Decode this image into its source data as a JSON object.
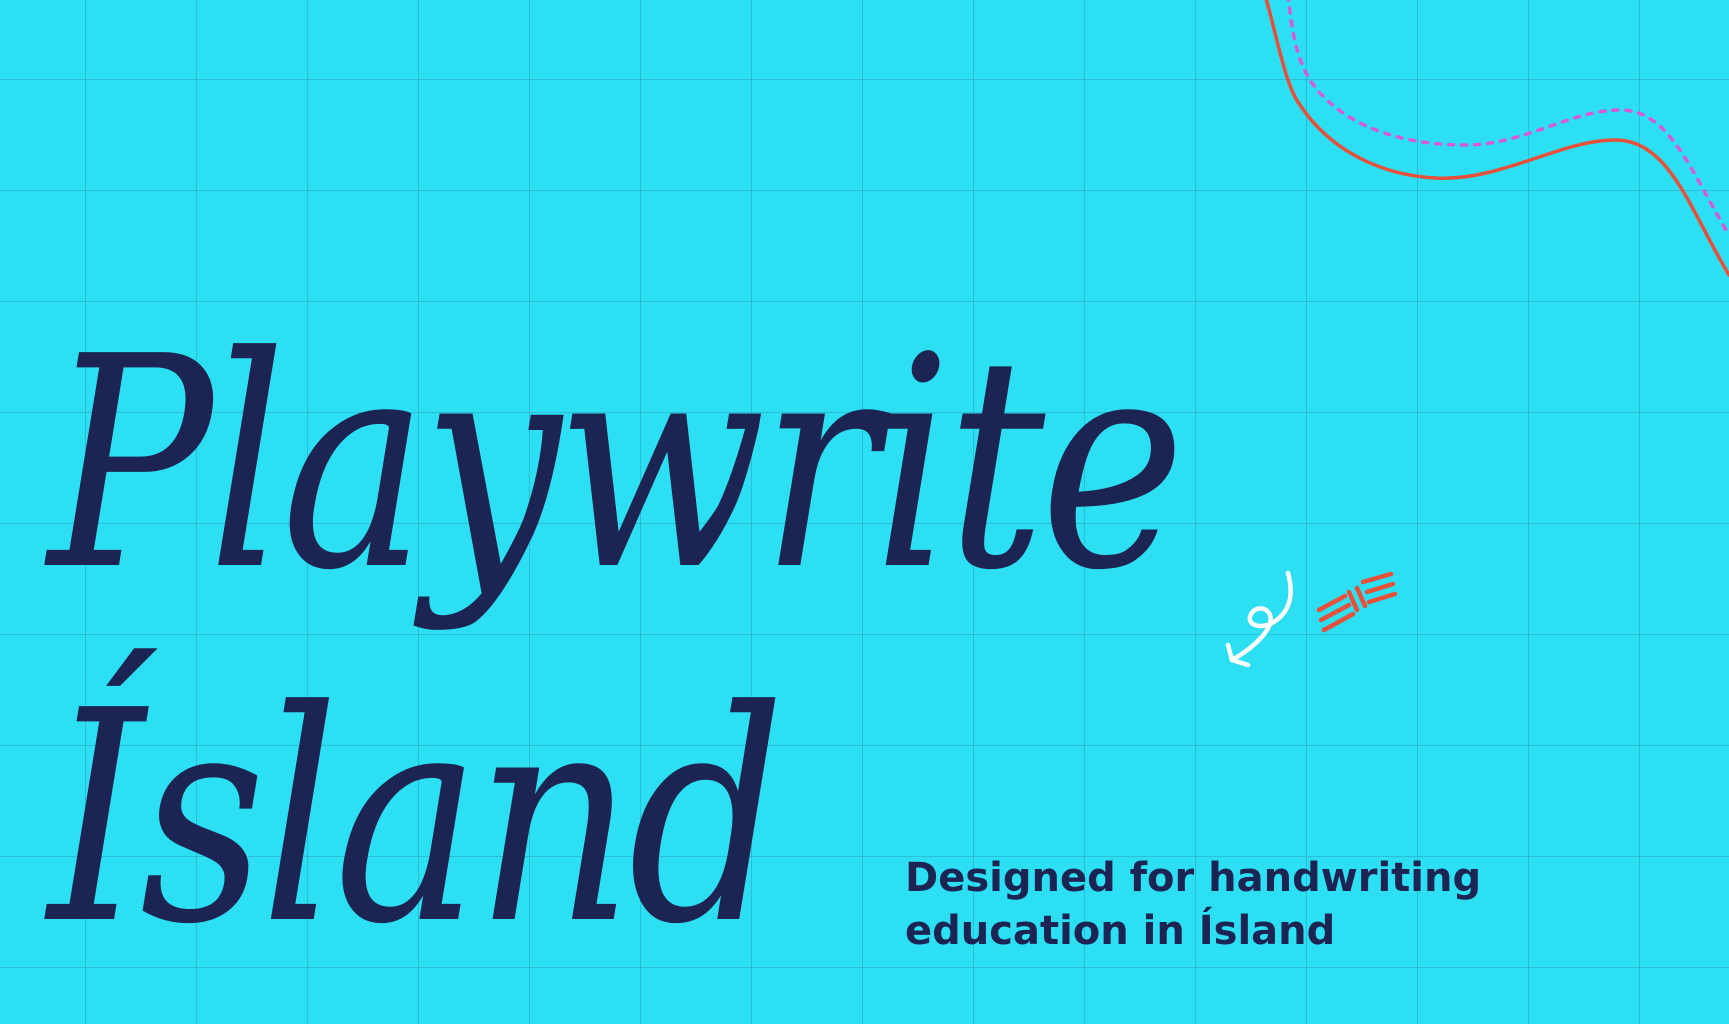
{
  "title": {
    "line1": "Playwrite",
    "line2": "Ísland"
  },
  "tagline": {
    "line1": "Designed for handwriting",
    "line2": "education in Ísland"
  },
  "colors": {
    "background": "#2ddff2",
    "grid": "#2896af",
    "text": "#1c2454",
    "accent_red": "#e8503a",
    "accent_pink": "#d85ad8",
    "loop_arrow": "#ffffff"
  }
}
